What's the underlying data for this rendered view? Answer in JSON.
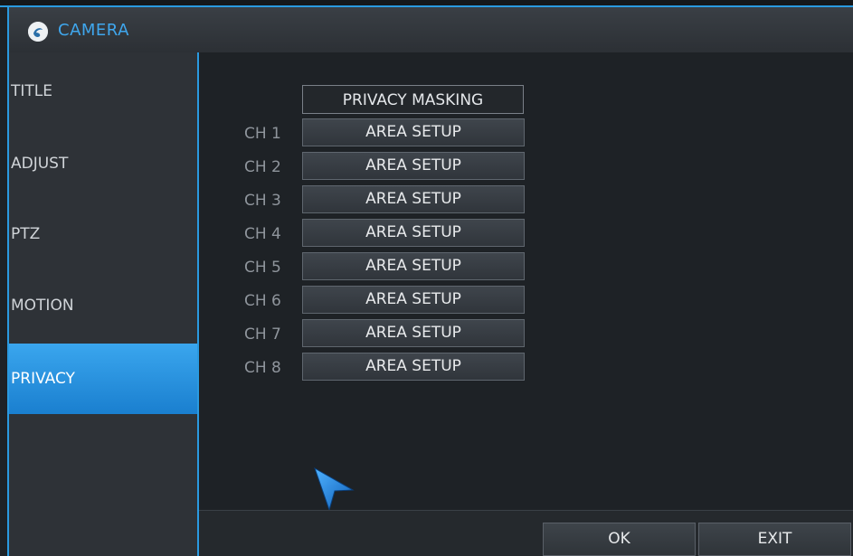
{
  "window": {
    "title": "CAMERA",
    "icon": "logo-icon"
  },
  "sidebar": {
    "items": [
      {
        "label": "TITLE",
        "active": false
      },
      {
        "label": "ADJUST",
        "active": false
      },
      {
        "label": "PTZ",
        "active": false
      },
      {
        "label": "MOTION",
        "active": false
      },
      {
        "label": "PRIVACY",
        "active": true
      }
    ]
  },
  "main": {
    "header": "PRIVACY MASKING",
    "channels": [
      {
        "label": "CH 1",
        "button": "AREA SETUP"
      },
      {
        "label": "CH 2",
        "button": "AREA SETUP"
      },
      {
        "label": "CH 3",
        "button": "AREA SETUP"
      },
      {
        "label": "CH 4",
        "button": "AREA SETUP"
      },
      {
        "label": "CH 5",
        "button": "AREA SETUP"
      },
      {
        "label": "CH 6",
        "button": "AREA SETUP"
      },
      {
        "label": "CH 7",
        "button": "AREA SETUP"
      },
      {
        "label": "CH 8",
        "button": "AREA SETUP"
      }
    ]
  },
  "footer": {
    "ok_label": "OK",
    "exit_label": "EXIT"
  },
  "colors": {
    "accent": "#2a9ae0",
    "active_item": "#2b93e0",
    "title_text": "#3fa7ee"
  }
}
